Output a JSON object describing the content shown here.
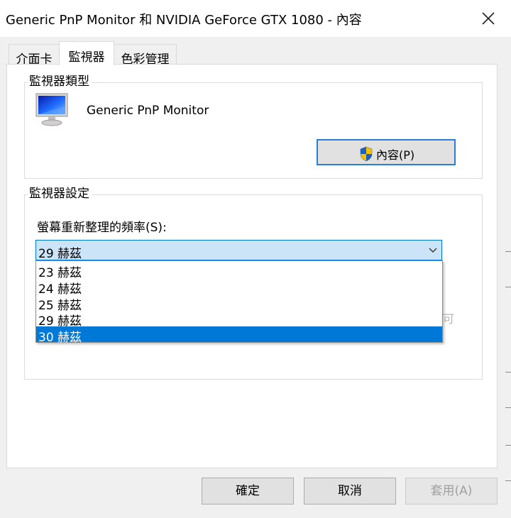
{
  "window": {
    "title": "Generic PnP Monitor 和 NVIDIA GeForce GTX 1080 - 內容"
  },
  "tabs": [
    {
      "label": "介面卡",
      "active": false
    },
    {
      "label": "監視器",
      "active": true
    },
    {
      "label": "色彩管理",
      "active": false
    }
  ],
  "monitor_type": {
    "group_title": "監視器類型",
    "monitor_name": "Generic PnP Monitor",
    "properties_button": "內容(P)"
  },
  "monitor_settings": {
    "group_title": "監視器設定",
    "refresh_label": "螢幕重新整理的頻率(S):",
    "selected_value": "29 赫茲",
    "options": [
      "23 赫茲",
      "24 赫茲",
      "25 赫茲",
      "29 赫茲",
      "30 赫茲"
    ],
    "highlighted_option": "30 赫茲",
    "obscured_text": "可"
  },
  "footer": {
    "ok_label": "確定",
    "cancel_label": "取消",
    "apply_label": "套用(A)",
    "apply_enabled": false
  },
  "colors": {
    "accent": "#0078d7",
    "combo_background": "#cce4f7",
    "dialog_background": "#f0f0f0",
    "shield_blue": "#1f5fbf",
    "shield_yellow": "#f2c200"
  },
  "icons": [
    "close-icon",
    "monitor-icon",
    "uac-shield-icon",
    "chevron-down-icon"
  ]
}
